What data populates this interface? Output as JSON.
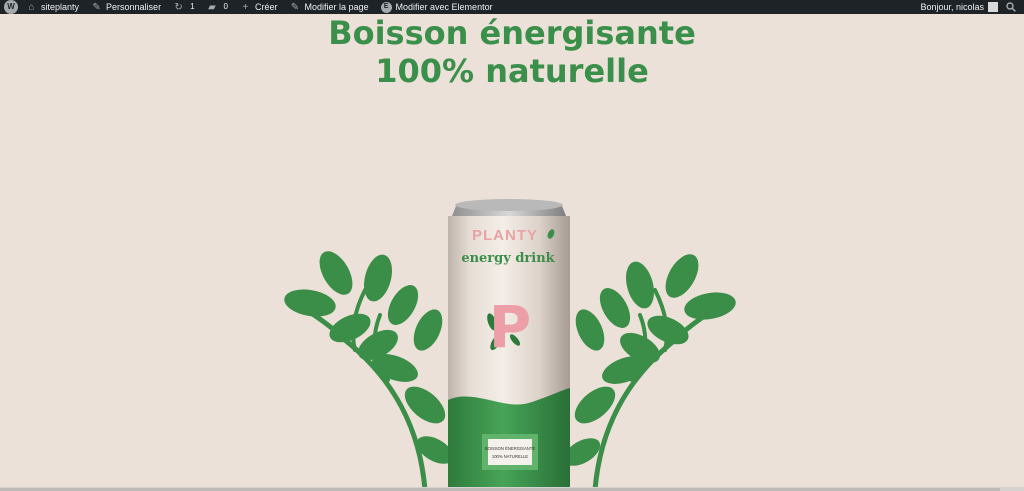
{
  "adminbar": {
    "site_name": "siteplanty",
    "customize": "Personnaliser",
    "updates_count": "1",
    "comments_count": "0",
    "new": "Créer",
    "edit_page": "Modifier la page",
    "edit_elementor": "Modifier avec Elementor",
    "greeting": "Bonjour, nicolas"
  },
  "hero": {
    "title_line1": "Boisson énergisante",
    "title_line2": "100% naturelle"
  },
  "can": {
    "brand": "PLANTY",
    "subtitle": "energy drink",
    "letter": "P",
    "label_line1": "BOISSON ÉNERGISANTE",
    "label_line2": "100% NATURELLE"
  },
  "colors": {
    "background": "#ece1d8",
    "accent_green": "#3a8f4a",
    "brand_pink": "#e8a3a3"
  }
}
